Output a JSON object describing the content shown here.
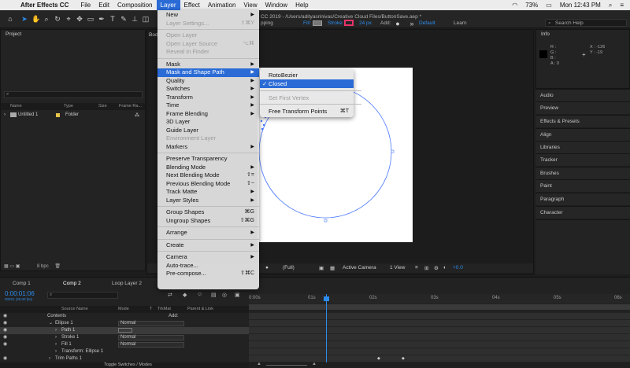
{
  "menubar": {
    "app": "After Effects CC",
    "items": [
      "File",
      "Edit",
      "Composition",
      "Layer",
      "Effect",
      "Animation",
      "View",
      "Window",
      "Help"
    ],
    "active": "Layer",
    "battery": "73%",
    "clock": "Mon 12:43 PM"
  },
  "toolbar": {
    "title_fragment": "CC 2019 - /Users/adityasrinivas/Creative Cloud Files/ButtonSave.aep *",
    "snapping_fragment": "pping",
    "fill_label": "Fill:",
    "stroke_label": "Stroke:",
    "stroke_px": "24 px",
    "add_label": "Add:",
    "workspace_default": "Default",
    "workspace_learn": "Learn",
    "search_placeholder": "Search Help"
  },
  "project_panel": {
    "title": "Project",
    "columns": [
      "Name",
      "Type",
      "Size",
      "Frame Ra..."
    ],
    "rows": [
      {
        "name": "Untitled 1",
        "type": "Folder"
      }
    ],
    "bpc": "8 bpc"
  },
  "comp_panel": {
    "tab_fragment": "Bod",
    "zoom_options": "(Full)",
    "camera": "Active Camera",
    "views": "1 View",
    "exposure": "+0.0"
  },
  "info_panel": {
    "title": "Info",
    "r": "R :",
    "g": "G :",
    "b": "B :",
    "a": "A : 0",
    "x": "X : -126",
    "y": "Y : -19"
  },
  "right_panels": [
    "Audio",
    "Preview",
    "Effects & Presets",
    "Align",
    "Libraries",
    "Tracker",
    "Brushes",
    "Paint",
    "Paragraph",
    "Character"
  ],
  "layer_menu": {
    "items": [
      {
        "label": "New",
        "submenu": true,
        "disabled": false
      },
      {
        "label": "Layer Settings...",
        "shortcut": "⇧⌘Y",
        "disabled": true
      },
      {
        "sep": true
      },
      {
        "label": "Open Layer",
        "disabled": true
      },
      {
        "label": "Open Layer Source",
        "shortcut": "⌥⌘",
        "disabled": true
      },
      {
        "label": "Reveal in Finder",
        "disabled": true
      },
      {
        "sep": true
      },
      {
        "label": "Mask",
        "submenu": true
      },
      {
        "label": "Mask and Shape Path",
        "submenu": true,
        "highlight": true
      },
      {
        "label": "Quality",
        "submenu": true
      },
      {
        "label": "Switches",
        "submenu": true
      },
      {
        "label": "Transform",
        "submenu": true
      },
      {
        "label": "Time",
        "submenu": true
      },
      {
        "label": "Frame Blending",
        "submenu": true
      },
      {
        "label": "3D Layer"
      },
      {
        "label": "Guide Layer"
      },
      {
        "label": "Environment Layer",
        "disabled": true
      },
      {
        "label": "Markers",
        "submenu": true
      },
      {
        "sep": true
      },
      {
        "label": "Preserve Transparency"
      },
      {
        "label": "Blending Mode",
        "submenu": true
      },
      {
        "label": "Next Blending Mode",
        "shortcut": "⇧="
      },
      {
        "label": "Previous Blending Mode",
        "shortcut": "⇧−"
      },
      {
        "label": "Track Matte",
        "submenu": true
      },
      {
        "label": "Layer Styles",
        "submenu": true
      },
      {
        "sep": true
      },
      {
        "label": "Group Shapes",
        "shortcut": "⌘G"
      },
      {
        "label": "Ungroup Shapes",
        "shortcut": "⇧⌘G"
      },
      {
        "sep": true
      },
      {
        "label": "Arrange",
        "submenu": true
      },
      {
        "sep": true
      },
      {
        "label": "Create",
        "submenu": true
      },
      {
        "sep": true
      },
      {
        "label": "Camera",
        "submenu": true
      },
      {
        "label": "Auto-trace..."
      },
      {
        "label": "Pre-compose...",
        "shortcut": "⇧⌘C"
      }
    ]
  },
  "submenu": {
    "items": [
      {
        "label": "RotoBezier"
      },
      {
        "label": "Closed",
        "checked": true,
        "highlight": true
      },
      {
        "sep": true
      },
      {
        "label": "Set First Vertex",
        "disabled": true
      },
      {
        "sep": true
      },
      {
        "label": "Free Transform Points",
        "shortcut": "⌘T"
      }
    ]
  },
  "timeline": {
    "tabs": [
      "Comp 1",
      "Comp 2",
      "Loop Layer 2"
    ],
    "timecode": "0:00:01:06",
    "timecode_sub": "00031 (25.00 fps)",
    "columns": [
      "Source Name",
      "Mode",
      "T",
      "TrkMat",
      "Parent & Link"
    ],
    "ruler": [
      "0:00s",
      "01s",
      "02s",
      "03s",
      "04s",
      "05s",
      "06s"
    ],
    "rows": [
      {
        "label": "Contents",
        "mode": "",
        "add": "Add:"
      },
      {
        "label": "Ellipse 1",
        "mode": "Normal"
      },
      {
        "label": "Path 1",
        "mode": ""
      },
      {
        "label": "Stroke 1",
        "mode": "Normal"
      },
      {
        "label": "Fill 1",
        "mode": "Normal"
      },
      {
        "label": "Transform: Ellipse 1",
        "mode": ""
      },
      {
        "label": "Trim Paths 1",
        "mode": ""
      }
    ],
    "footer": "Toggle Switches / Modes"
  },
  "colors": {
    "accent": "#2a6bd6",
    "timeline_blue": "#2d8ceb",
    "stroke_swatch": "#e8336b",
    "fill_swatch": "#777777"
  }
}
